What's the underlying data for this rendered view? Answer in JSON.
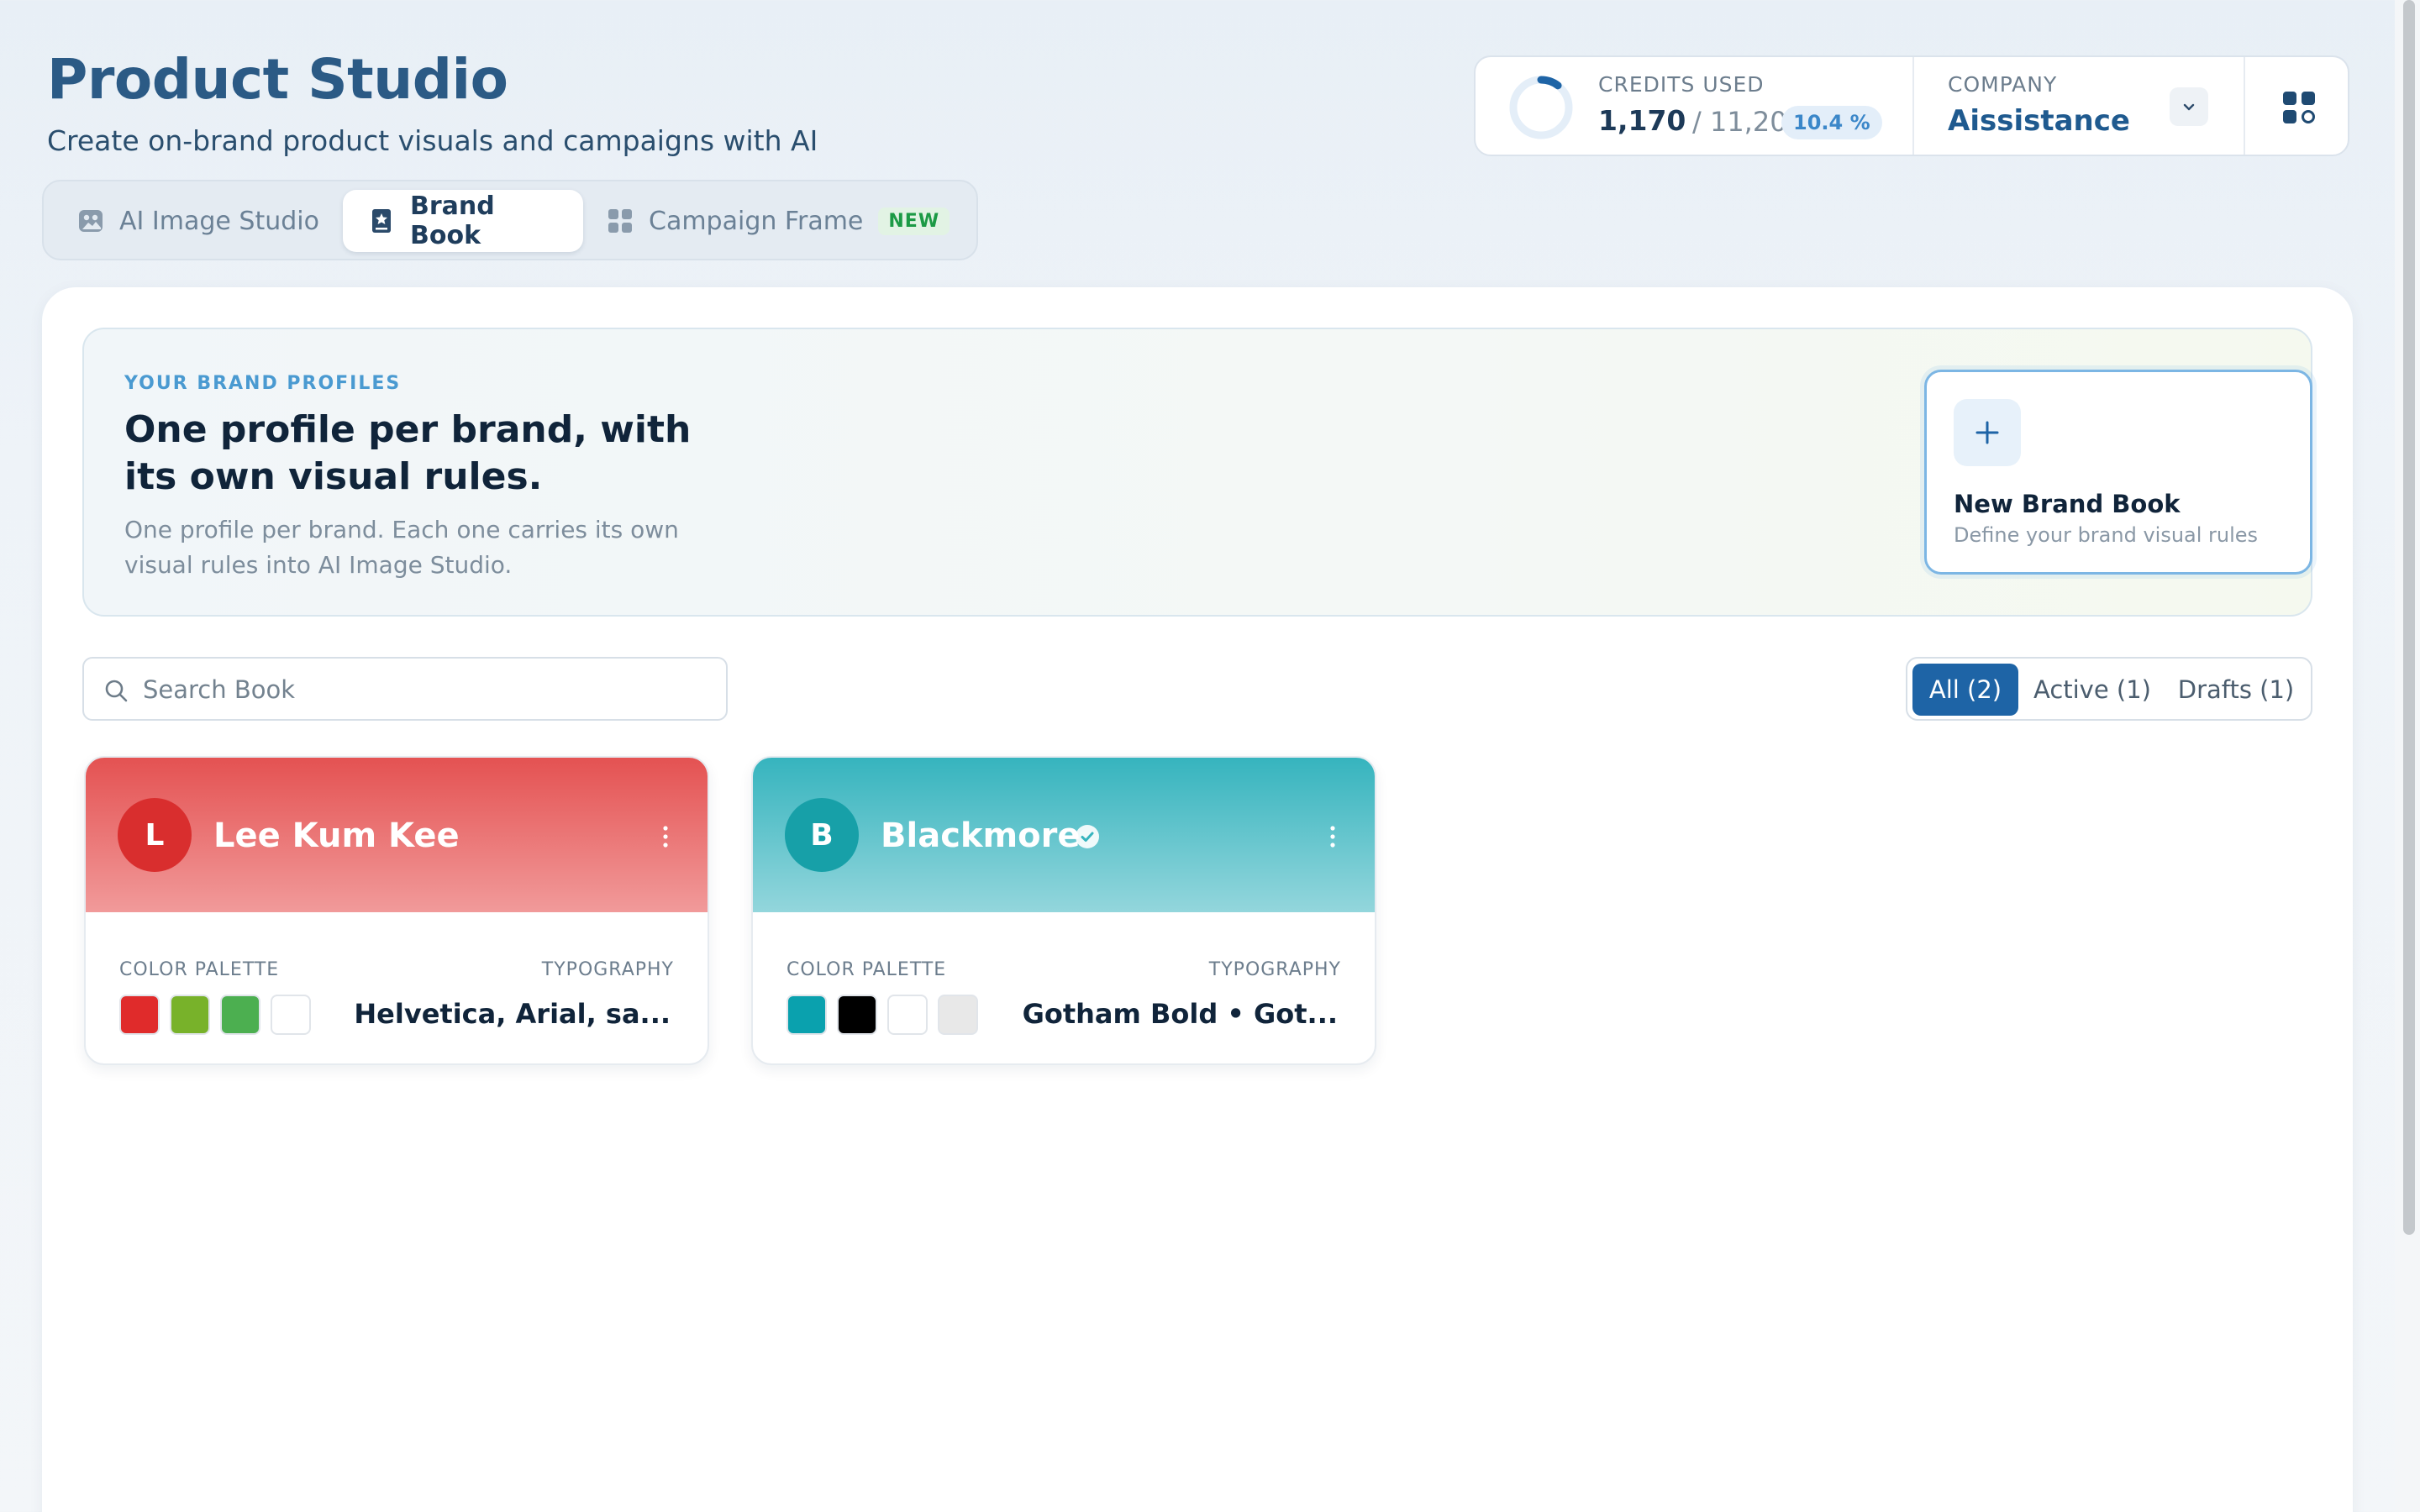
{
  "header": {
    "title": "Product Studio",
    "subtitle": "Create on-brand product visuals and campaigns with AI"
  },
  "tabs": [
    {
      "label": "AI Image Studio",
      "icon": "image-icon",
      "active": false
    },
    {
      "label": "Brand Book",
      "icon": "book-icon",
      "active": true
    },
    {
      "label": "Campaign Frame",
      "icon": "grid-icon",
      "active": false,
      "badge": "NEW"
    }
  ],
  "credits": {
    "label": "CREDITS USED",
    "used": "1,170",
    "total": "/ 11,200",
    "percent": "10.4 %",
    "fraction": 0.104,
    "company_label": "COMPANY",
    "company": "Aissistance"
  },
  "hero": {
    "eyebrow": "YOUR BRAND PROFILES",
    "headline": "One profile per brand, with its own visual rules.",
    "description": "One profile per brand. Each one carries its own visual rules into AI Image Studio.",
    "new_card_title": "New Brand Book",
    "new_card_sub": "Define your brand visual rules"
  },
  "search": {
    "placeholder": "Search Book",
    "value": ""
  },
  "filters": [
    {
      "label": "All (2)",
      "active": true
    },
    {
      "label": "Active (1)",
      "active": false
    },
    {
      "label": "Drafts (1)",
      "active": false
    }
  ],
  "brands": [
    {
      "initial": "L",
      "name": "Lee Kum Kee",
      "verified": false,
      "palette_label": "COLOR PALETTE",
      "typography_label": "TYPOGRAPHY",
      "colors": [
        "#e02b2b",
        "#78b22a",
        "#4caf50",
        "#ffffff"
      ],
      "typography": "Helvetica, Arial, sa..."
    },
    {
      "initial": "B",
      "name": "Blackmore",
      "verified": true,
      "palette_label": "COLOR PALETTE",
      "typography_label": "TYPOGRAPHY",
      "colors": [
        "#0aa1ae",
        "#000000",
        "#ffffff",
        "#e8e8e8"
      ],
      "typography": "Gotham Bold • Got..."
    }
  ],
  "colors": {
    "accent": "#1e64a6",
    "title": "#2b5a85",
    "new_badge": "#1c9a45"
  }
}
